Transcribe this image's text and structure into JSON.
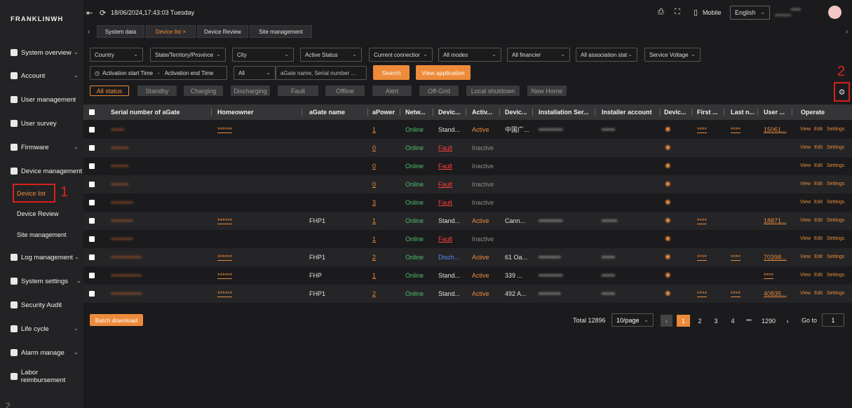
{
  "logo": "FRANKLINWH",
  "sidebar": {
    "items": [
      {
        "label": "System overview"
      },
      {
        "label": "Account"
      },
      {
        "label": "User management"
      },
      {
        "label": "User survey"
      },
      {
        "label": "Firmware"
      },
      {
        "label": "Device management"
      },
      {
        "label": "Log management"
      },
      {
        "label": "System settings"
      },
      {
        "label": "Security Audit"
      },
      {
        "label": "Life cycle"
      },
      {
        "label": "Alarm manage"
      },
      {
        "label": "Labor reimbursement"
      }
    ],
    "sub_items": [
      {
        "label": "Device list"
      },
      {
        "label": "Device Review"
      },
      {
        "label": "Site management"
      }
    ]
  },
  "annotations": {
    "one": "1",
    "two": "2",
    "bottom": "2"
  },
  "header": {
    "datetime": "18/06/2024,17:43:03 Tuesday",
    "mobile": "Mobile",
    "language": "English",
    "user_name": "•••••",
    "user_sub": "•••••••••••",
    "tabs": [
      {
        "label": "System data"
      },
      {
        "label": "Device list ×"
      },
      {
        "label": "Device Review"
      },
      {
        "label": "Site management"
      }
    ]
  },
  "filters": {
    "country": "Country",
    "state": "State/Territory/Province",
    "city": "City",
    "active_status": "Active Status",
    "current_connection": "Current connectior",
    "modes": "All modes",
    "financier": "All financier",
    "association": "All association stat",
    "voltage": "Service Voltage",
    "activation_start": "Activation start Time",
    "dash": "-",
    "activation_end": "Activation end Time",
    "all": "All",
    "search_placeholder": "aGate name, Serial number ...",
    "search_btn": "Search",
    "view_application_btn": "View application"
  },
  "status_chips": [
    "All status",
    "Standby",
    "Charging",
    "Discharging",
    "Fault",
    "Offline",
    "Alert",
    "Off-Grid",
    "Local shutdown",
    "New Home"
  ],
  "table": {
    "headers": [
      "Serial number of aGate",
      "Homeowner",
      "aGate name",
      "aPower",
      "Netw...",
      "Devic...",
      "Activ...",
      "Devic...",
      "Installation Ser...",
      "Installer account",
      "Devic...",
      "First ...",
      "Last n...",
      "User ...",
      "Operate"
    ],
    "rows": [
      {
        "serial": "••••••",
        "homeowner": "******",
        "agate": "",
        "apower": "1",
        "network": "Online",
        "device_status": "Stand...",
        "active": "Active",
        "devic": "中国广...",
        "install": "•••••••••••",
        "installer": "••••••",
        "first": "****",
        "last": "****",
        "user": "15061..."
      },
      {
        "serial": "••••••••",
        "homeowner": "",
        "agate": "",
        "apower": "0",
        "network": "Online",
        "device_status": "Fault",
        "active": "Inactive",
        "devic": "",
        "install": "",
        "installer": "",
        "first": "",
        "last": "",
        "user": ""
      },
      {
        "serial": "••••••••",
        "homeowner": "",
        "agate": "",
        "apower": "0",
        "network": "Online",
        "device_status": "Fault",
        "active": "Inactive",
        "devic": "",
        "install": "",
        "installer": "",
        "first": "",
        "last": "",
        "user": ""
      },
      {
        "serial": "••••••••",
        "homeowner": "",
        "agate": "",
        "apower": "0",
        "network": "Online",
        "device_status": "Fault",
        "active": "Inactive",
        "devic": "",
        "install": "",
        "installer": "",
        "first": "",
        "last": "",
        "user": ""
      },
      {
        "serial": "••••••••••",
        "homeowner": "",
        "agate": "",
        "apower": "3",
        "network": "Online",
        "device_status": "Fault",
        "active": "Inactive",
        "devic": "",
        "install": "",
        "installer": "",
        "first": "",
        "last": "",
        "user": ""
      },
      {
        "serial": "••••••••••",
        "homeowner": "******",
        "agate": "FHP1",
        "apower": "1",
        "network": "Online",
        "device_status": "Stand...",
        "active": "Active",
        "devic": "Cann...",
        "install": "•••••••••••",
        "installer": "•••••••",
        "first": "****",
        "last": "",
        "user": "18871..."
      },
      {
        "serial": "••••••••••",
        "homeowner": "",
        "agate": "",
        "apower": "1",
        "network": "Online",
        "device_status": "Fault",
        "active": "Inactive",
        "devic": "",
        "install": "",
        "installer": "",
        "first": "",
        "last": "",
        "user": ""
      },
      {
        "serial": "••••••••••••••",
        "homeowner": "******",
        "agate": "FHP1",
        "apower": "2",
        "network": "Online",
        "device_status": "Disch...",
        "active": "Active",
        "devic": "61 Oa...",
        "install": "••••••••••",
        "installer": "••••••",
        "first": "****",
        "last": "****",
        "user": "70398..."
      },
      {
        "serial": "••••••••••••••",
        "homeowner": "******",
        "agate": "FHP",
        "apower": "1",
        "network": "Online",
        "device_status": "Stand...",
        "active": "Active",
        "devic": "339 ...",
        "install": "•••••••••••",
        "installer": "••••••",
        "first": "",
        "last": "",
        "user": "****"
      },
      {
        "serial": "••••••••••••••",
        "homeowner": "******",
        "agate": "FHP1",
        "apower": "2",
        "network": "Online",
        "device_status": "Stand...",
        "active": "Active",
        "devic": "492 A...",
        "install": "••••••••••",
        "installer": "••••••",
        "first": "****",
        "last": "****",
        "user": "40835..."
      }
    ],
    "ops": {
      "view": "View",
      "edit": "Edit",
      "settings": "Settings"
    }
  },
  "batch_download": "Batch download",
  "pagination": {
    "total": "Total 12896",
    "per_page": "10/page",
    "pages": [
      "1",
      "2",
      "3",
      "4",
      "•••",
      "1290"
    ],
    "goto_label": "Go to",
    "goto_value": "1"
  },
  "colors": {
    "accent": "#ed8b3a",
    "online": "#4fbf72",
    "fault": "#ff3d3d",
    "discharging": "#4f8ff0",
    "highlight": "#d8201c"
  }
}
